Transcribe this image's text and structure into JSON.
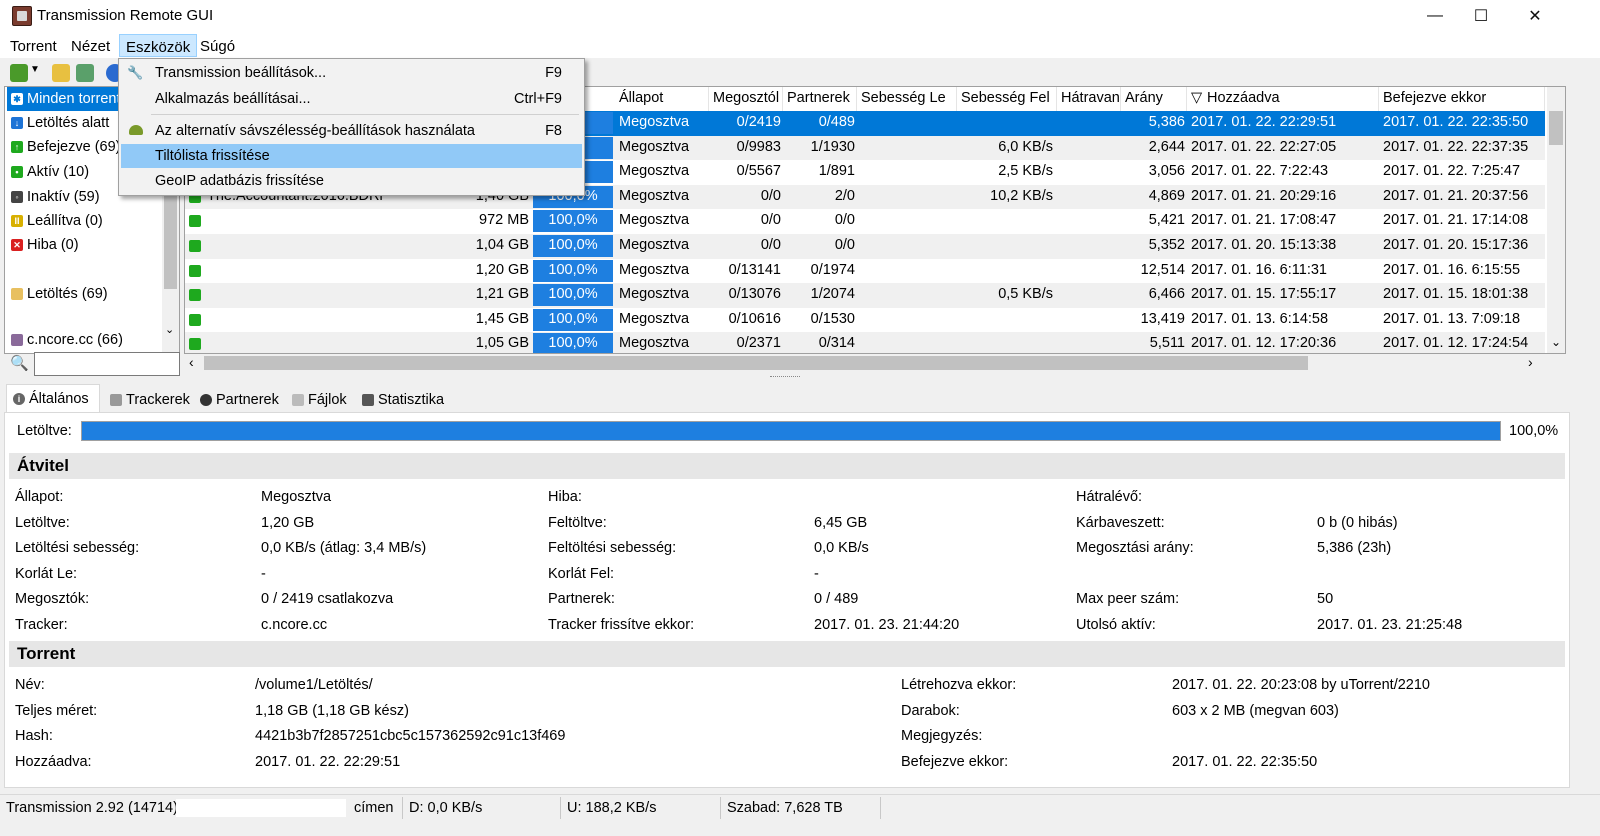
{
  "window": {
    "title": "Transmission Remote GUI",
    "minimize": "—",
    "maximize": "☐",
    "close": "✕"
  },
  "menubar": [
    "Torrent",
    "Nézet",
    "Eszközök",
    "Súgó"
  ],
  "dropdown": {
    "items": [
      {
        "label": "Transmission beállítások...",
        "shortcut": "F9"
      },
      {
        "label": "Alkalmazás beállításai...",
        "shortcut": "Ctrl+F9"
      },
      {
        "label": "Az alternatív sávszélesség-beállítások használata",
        "shortcut": "F8"
      },
      {
        "label": "Tiltólista frissítése",
        "shortcut": ""
      },
      {
        "label": "GeoIP adatbázis frissítése",
        "shortcut": ""
      }
    ]
  },
  "sidebar": {
    "items": [
      {
        "label": "Minden torrent",
        "color": "#ffffff"
      },
      {
        "label": "Letöltés alatt",
        "color": "#1e74d6"
      },
      {
        "label": "Befejezve (69)",
        "color": "#1ea91e"
      },
      {
        "label": "Aktív (10)",
        "color": "#1ea91e"
      },
      {
        "label": "Inaktív (59)",
        "color": "#444444"
      },
      {
        "label": "Leállítva (0)",
        "color": "#d8b000"
      },
      {
        "label": "Hiba (0)",
        "color": "#d92020"
      },
      {
        "label": "Letöltés (69)",
        "color": "#e8c060"
      },
      {
        "label": "c.ncore.cc (66)",
        "color": "#8a6a9a"
      }
    ],
    "search_placeholder": ""
  },
  "list": {
    "headers": [
      "Állapot",
      "Megosztól",
      "Partnerek",
      "Sebesség Le",
      "Sebesség Fel",
      "Hátravan",
      "Arány",
      "Hozzáadva",
      "Befejezve ekkor"
    ],
    "rows": [
      {
        "name": "",
        "size": "",
        "pct": "%",
        "status": "Megosztva",
        "seeds": "0/2419",
        "peers": "0/489",
        "down": "",
        "up": "",
        "ratio": "5,386",
        "added": "2017. 01. 22. 22:29:51",
        "done": "2017. 01. 22. 22:35:50"
      },
      {
        "name": "",
        "size": "",
        "pct": "%",
        "status": "Megosztva",
        "seeds": "0/9983",
        "peers": "1/1930",
        "down": "",
        "up": "6,0 KB/s",
        "ratio": "2,644",
        "added": "2017. 01. 22. 22:27:05",
        "done": "2017. 01. 22. 22:37:35"
      },
      {
        "name": "",
        "size": "",
        "pct": "%",
        "status": "Megosztva",
        "seeds": "0/5567",
        "peers": "1/891",
        "down": "",
        "up": "2,5 KB/s",
        "ratio": "3,056",
        "added": "2017. 01. 22. 7:22:43",
        "done": "2017. 01. 22. 7:25:47"
      },
      {
        "name": "The.Accountant.2016.BDRi",
        "size": "1,40 GB",
        "pct": "100,0%",
        "status": "Megosztva",
        "seeds": "0/0",
        "peers": "2/0",
        "down": "",
        "up": "10,2 KB/s",
        "ratio": "4,869",
        "added": "2017. 01. 21. 20:29:16",
        "done": "2017. 01. 21. 20:37:56"
      },
      {
        "name": "",
        "size": "972 MB",
        "pct": "100,0%",
        "status": "Megosztva",
        "seeds": "0/0",
        "peers": "0/0",
        "down": "",
        "up": "",
        "ratio": "5,421",
        "added": "2017. 01. 21. 17:08:47",
        "done": "2017. 01. 21. 17:14:08"
      },
      {
        "name": "",
        "size": "1,04 GB",
        "pct": "100,0%",
        "status": "Megosztva",
        "seeds": "0/0",
        "peers": "0/0",
        "down": "",
        "up": "",
        "ratio": "5,352",
        "added": "2017. 01. 20. 15:13:38",
        "done": "2017. 01. 20. 15:17:36"
      },
      {
        "name": "",
        "size": "1,20 GB",
        "pct": "100,0%",
        "status": "Megosztva",
        "seeds": "0/13141",
        "peers": "0/1974",
        "down": "",
        "up": "",
        "ratio": "12,514",
        "added": "2017. 01. 16. 6:11:31",
        "done": "2017. 01. 16. 6:15:55"
      },
      {
        "name": "",
        "size": "1,21 GB",
        "pct": "100,0%",
        "status": "Megosztva",
        "seeds": "0/13076",
        "peers": "1/2074",
        "down": "",
        "up": "0,5 KB/s",
        "ratio": "6,466",
        "added": "2017. 01. 15. 17:55:17",
        "done": "2017. 01. 15. 18:01:38"
      },
      {
        "name": "",
        "size": "1,45 GB",
        "pct": "100,0%",
        "status": "Megosztva",
        "seeds": "0/10616",
        "peers": "0/1530",
        "down": "",
        "up": "",
        "ratio": "13,419",
        "added": "2017. 01. 13. 6:14:58",
        "done": "2017. 01. 13. 7:09:18"
      },
      {
        "name": "",
        "size": "1,05 GB",
        "pct": "100,0%",
        "status": "Megosztva",
        "seeds": "0/2371",
        "peers": "0/314",
        "down": "",
        "up": "",
        "ratio": "5,511",
        "added": "2017. 01. 12. 17:20:36",
        "done": "2017. 01. 12. 17:24:54"
      }
    ]
  },
  "tabs": [
    "Általános",
    "Trackerek",
    "Partnerek",
    "Fájlok",
    "Statisztika"
  ],
  "general": {
    "downloaded_label": "Letöltve:",
    "progress": 1.0,
    "progress_text": "100,0%",
    "transfer_title": "Átvitel",
    "transfer": [
      [
        "Állapot:",
        "Megosztva",
        "Hiba:",
        "",
        "Hátralévő:",
        ""
      ],
      [
        "Letöltve:",
        "1,20 GB",
        "Feltöltve:",
        "6,45 GB",
        "Kárbaveszett:",
        "0 b (0 hibás)"
      ],
      [
        "Letöltési sebesség:",
        "0,0 KB/s (átlag: 3,4 MB/s)",
        "Feltöltési sebesség:",
        "0,0 KB/s",
        "Megosztási arány:",
        "5,386 (23h)"
      ],
      [
        "Korlát Le:",
        "-",
        "Korlát Fel:",
        "-",
        "",
        ""
      ],
      [
        "Megosztók:",
        "0 / 2419 csatlakozva",
        "Partnerek:",
        "0 / 489",
        "Max peer szám:",
        "50"
      ],
      [
        "Tracker:",
        "c.ncore.cc",
        "Tracker frissítve ekkor:",
        "2017. 01. 23. 21:44:20",
        "Utolsó aktív:",
        "2017. 01. 23. 21:25:48"
      ]
    ],
    "torrent_title": "Torrent",
    "torrent": [
      [
        "Név:",
        "/volume1/Letöltés/",
        "Létrehozva ekkor:",
        "2017. 01. 22. 20:23:08 by uTorrent/2210"
      ],
      [
        "Teljes méret:",
        "1,18 GB (1,18 GB kész)",
        "Darabok:",
        "603 x 2 MB (megvan 603)"
      ],
      [
        "Hash:",
        "4421b3b7f2857251cbc5c157362592c91c13f469",
        "Megjegyzés:",
        ""
      ],
      [
        "Hozzáadva:",
        "2017. 01. 22. 22:29:51",
        "Befejezve ekkor:",
        "2017. 01. 22. 22:35:50"
      ]
    ]
  },
  "statusbar": {
    "version": "Transmission 2.92 (14714)",
    "address_suffix": "címen",
    "down": "D: 0,0 KB/s",
    "up": "U: 188,2 KB/s",
    "free": "Szabad: 7,628 TB"
  }
}
